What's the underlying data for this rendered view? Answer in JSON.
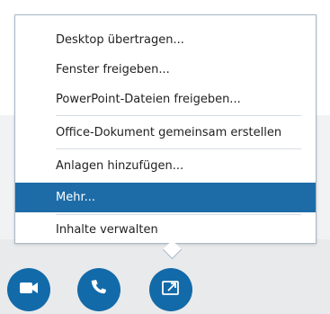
{
  "menu": {
    "items": [
      {
        "label": "Desktop übertragen..."
      },
      {
        "label": "Fenster freigeben..."
      },
      {
        "label": "PowerPoint-Dateien freigeben..."
      },
      {
        "label": "Office-Dokument gemeinsam erstellen"
      },
      {
        "label": "Anlagen hinzufügen..."
      },
      {
        "label": "Mehr..."
      },
      {
        "label": "Inhalte verwalten"
      }
    ],
    "selected_index": 5
  },
  "toolbar": {
    "buttons": [
      {
        "icon": "video-camera-icon"
      },
      {
        "icon": "phone-icon"
      },
      {
        "icon": "share-screen-icon"
      }
    ]
  },
  "colors": {
    "accent": "#1d6ca8",
    "button": "#126aa9"
  }
}
